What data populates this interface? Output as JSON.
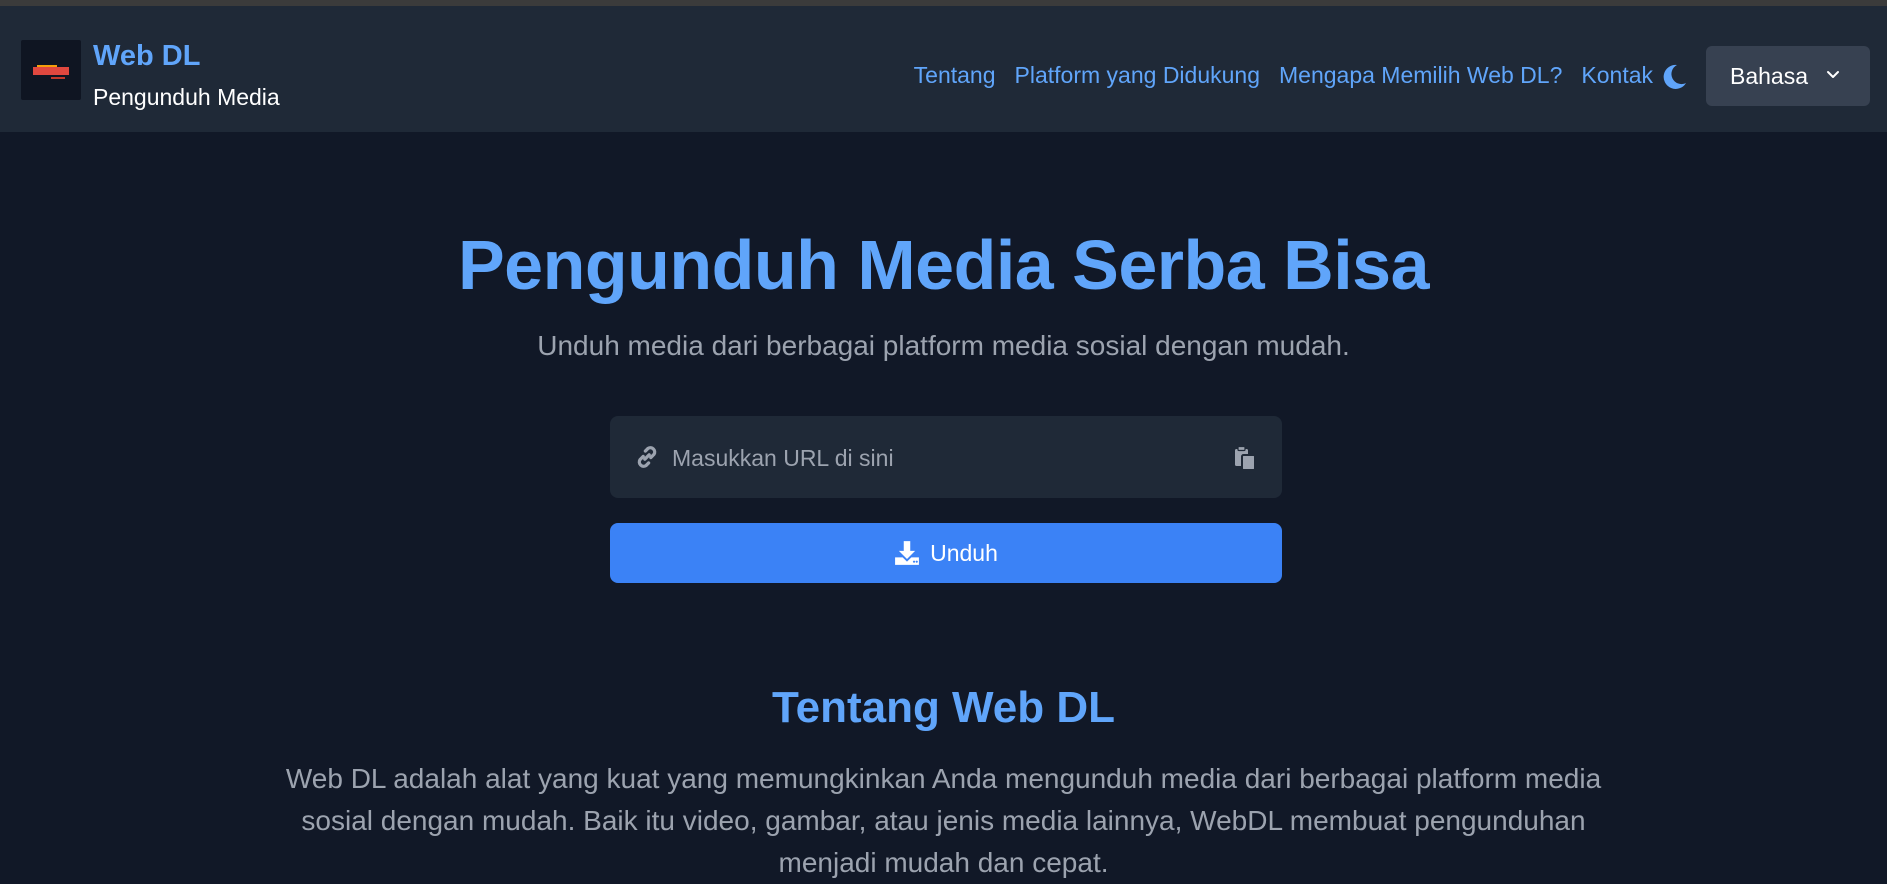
{
  "brand": {
    "name": "Web DL",
    "subtitle": "Pengunduh Media"
  },
  "nav": {
    "links": [
      "Tentang",
      "Platform yang Didukung",
      "Mengapa Memilih Web DL?",
      "Kontak"
    ],
    "theme_icon": "moon-icon",
    "language_label": "Bahasa"
  },
  "hero": {
    "title": "Pengunduh Media Serba Bisa",
    "subtitle": "Unduh media dari berbagai platform media sosial dengan mudah."
  },
  "url_input": {
    "placeholder": "Masukkan URL di sini",
    "value": "",
    "leading_icon": "link-icon",
    "trailing_icon": "paste-icon"
  },
  "download_button": {
    "label": "Unduh",
    "icon": "download-icon"
  },
  "about": {
    "title": "Tentang Web DL",
    "text": "Web DL adalah alat yang kuat yang memungkinkan Anda mengunduh media dari berbagai platform media sosial dengan mudah. Baik itu video, gambar, atau jenis media lainnya, WebDL membuat pengunduhan menjadi mudah dan cepat."
  },
  "colors": {
    "background": "#111827",
    "navbar": "#1f2937",
    "accent": "#60a5fa",
    "button": "#3b82f6",
    "muted_text": "#9ca3af"
  }
}
